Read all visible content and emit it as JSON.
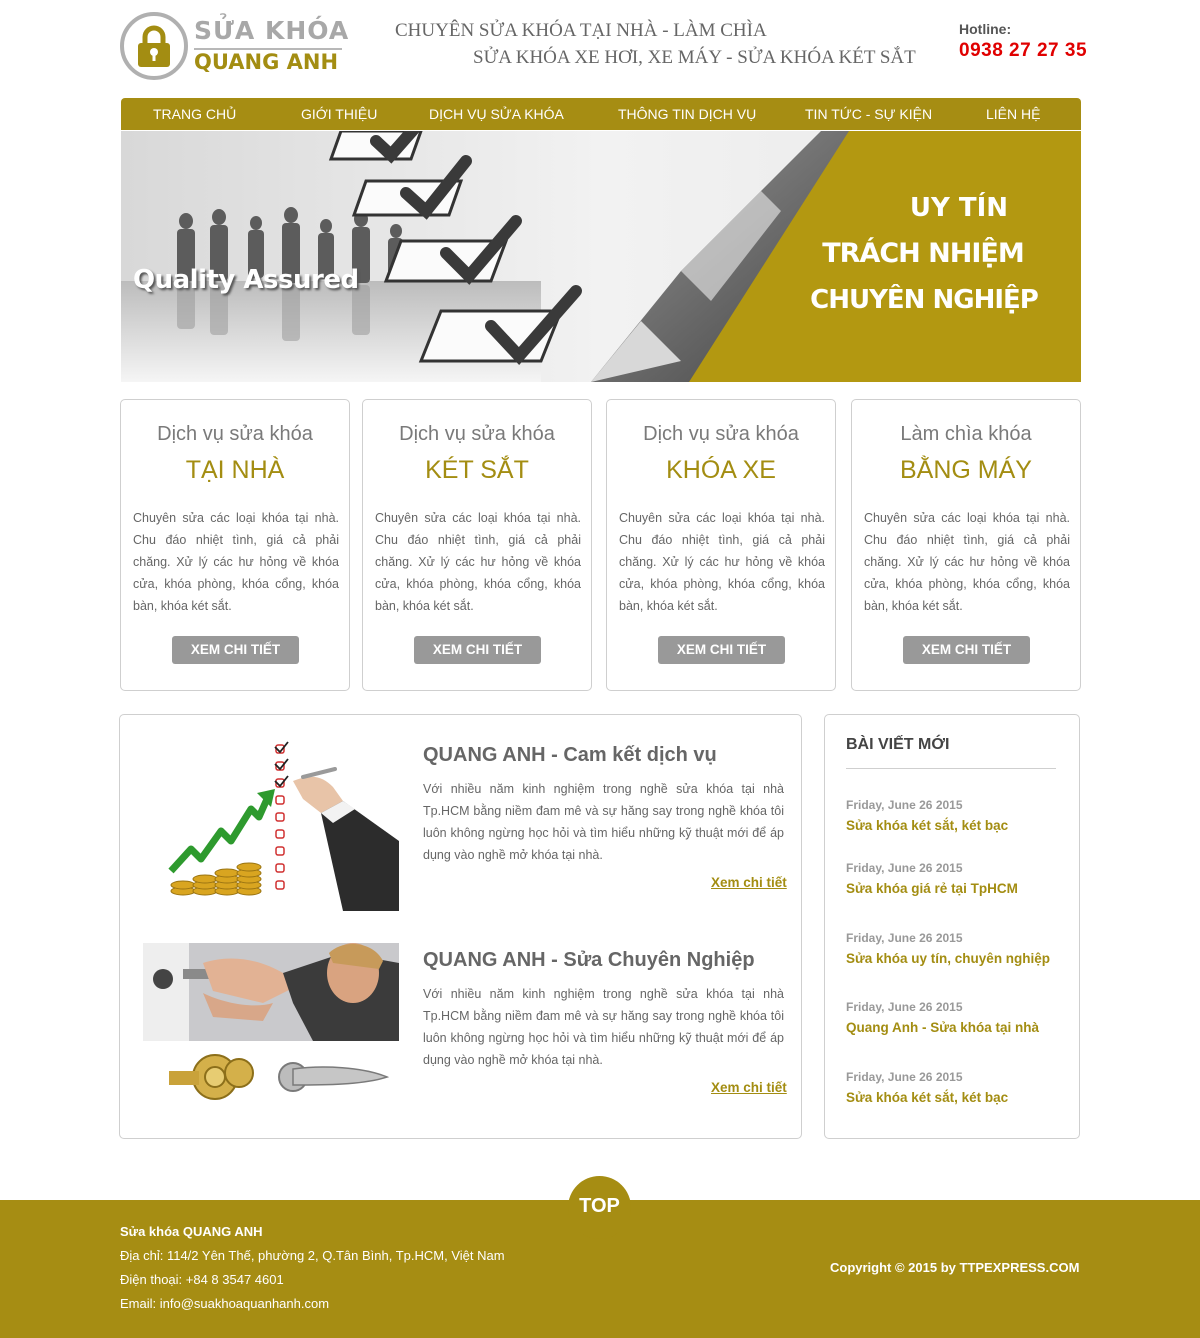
{
  "colors": {
    "brand": "#a68d13",
    "brand_text": "#a38d12",
    "hotline": "#e00000",
    "button_grey": "#999999"
  },
  "logo": {
    "line1": "SỬA KHÓA",
    "line2": "QUANG ANH",
    "icon": "padlock-icon"
  },
  "header": {
    "slogan1": "CHUYÊN SỬA KHÓA TẠI NHÀ - LÀM CHÌA",
    "slogan2": "SỬA KHÓA XE HƠI, XE MÁY - SỬA KHÓA KÉT SẮT",
    "hotline_label": "Hotline:",
    "hotline_number": "0938 27 27 35"
  },
  "nav": {
    "items": [
      {
        "label": "TRANG CHỦ"
      },
      {
        "label": "GIỚI THIỆU"
      },
      {
        "label": "DỊCH VỤ SỬA KHÓA"
      },
      {
        "label": "THÔNG TIN DỊCH VỤ"
      },
      {
        "label": "TIN TỨC - SỰ KIỆN"
      },
      {
        "label": "LIÊN HỆ"
      }
    ]
  },
  "banner": {
    "quality": "Quality Assured",
    "line1": "UY TÍN",
    "line2": "TRÁCH NHIỆM",
    "line3": "CHUYÊN NGHIỆP"
  },
  "services": [
    {
      "sub": "Dịch vụ sửa khóa",
      "title": "TẠI NHÀ",
      "desc": "Chuyên sửa các loại khóa tại nhà. Chu đáo nhiệt tình, giá cả phải chăng. Xử lý các hư hỏng về khóa cửa, khóa phòng, khóa cổng, khóa bàn, khóa két sắt.",
      "button": "XEM CHI TIẾT"
    },
    {
      "sub": "Dịch vụ sửa khóa",
      "title": "KÉT SẮT",
      "desc": "Chuyên sửa các loại khóa tại nhà. Chu đáo nhiệt tình, giá cả phải chăng. Xử lý các hư hỏng về khóa cửa, khóa phòng, khóa cổng, khóa bàn, khóa két sắt.",
      "button": "XEM CHI TIẾT"
    },
    {
      "sub": "Dịch vụ sửa khóa",
      "title": "KHÓA XE",
      "desc": "Chuyên sửa các loại khóa tại nhà. Chu đáo nhiệt tình, giá cả phải chăng. Xử lý các hư hỏng về khóa cửa, khóa phòng, khóa cổng, khóa bàn, khóa két sắt.",
      "button": "XEM CHI TIẾT"
    },
    {
      "sub": "Làm chìa khóa",
      "title": "BẰNG MÁY",
      "desc": "Chuyên sửa các loại khóa tại nhà. Chu đáo nhiệt tình, giá cả phải chăng. Xử lý các hư hỏng về khóa cửa, khóa phòng, khóa cổng, khóa bàn, khóa két sắt.",
      "button": "XEM CHI TIẾT"
    }
  ],
  "articles": [
    {
      "title": "QUANG ANH - Cam kết dịch vụ",
      "desc": "Với nhiều năm kinh nghiệm trong nghề sửa khóa tại nhà Tp.HCM bằng niềm đam mê và sự hăng say trong nghề khóa tôi luôn không ngừng học hỏi và tìm hiểu những kỹ thuật mới để áp dụng vào nghề mở khóa tại nhà.",
      "more": "Xem chi tiết"
    },
    {
      "title": "QUANG ANH - Sửa Chuyên Nghiệp",
      "desc": "Với nhiều năm kinh nghiệm trong nghề sửa khóa tại nhà Tp.HCM bằng niềm đam mê và sự hăng say trong nghề khóa tôi luôn không ngừng học hỏi và tìm hiểu những kỹ thuật mới để áp dụng vào nghề mở khóa tại nhà.",
      "more": "Xem chi tiết"
    }
  ],
  "sidebar": {
    "title": "BÀI VIẾT MỚI",
    "posts": [
      {
        "date": "Friday, June 26 2015",
        "title": "Sửa khóa két sắt, két bạc"
      },
      {
        "date": "Friday, June 26 2015",
        "title": "Sửa khóa giá rẻ tại TpHCM"
      },
      {
        "date": "Friday, June 26 2015",
        "title": "Sửa khóa uy tín, chuyên nghiệp"
      },
      {
        "date": "Friday, June 26 2015",
        "title": "Quang Anh - Sửa khóa tại nhà"
      },
      {
        "date": "Friday, June 26 2015",
        "title": "Sửa khóa két sắt, két bạc"
      }
    ]
  },
  "footer": {
    "top": "TOP",
    "name": "Sửa khóa QUANG ANH",
    "address": "Địa chỉ: 114/2 Yên Thế, phường 2, Q.Tân Bình, Tp.HCM, Việt Nam",
    "phone": "Điện thoại: +84 8 3547 4601",
    "email": "Email: info@suakhoaquanhanh.com",
    "copyright": "Copyright © 2015 by TTPEXPRESS.COM"
  }
}
